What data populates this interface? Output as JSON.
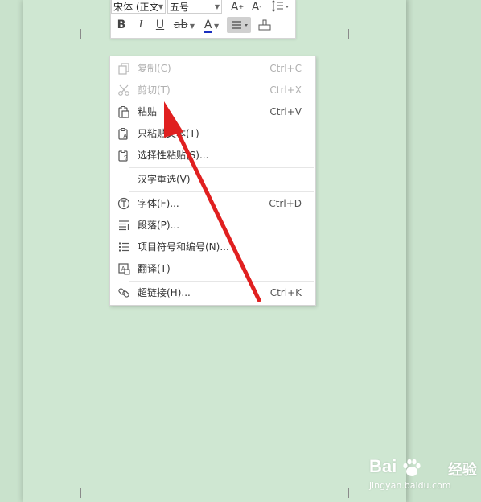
{
  "toolbar": {
    "font_name": "宋体 (正文",
    "font_size": "五号",
    "grow_font": "A",
    "shrink_font": "A",
    "bold": "B",
    "italic": "I",
    "underline": "U",
    "highlight": "ab",
    "font_color": "A"
  },
  "menu": {
    "items": [
      {
        "label": "复制(C)",
        "shortcut": "Ctrl+C",
        "icon": "copy-icon",
        "enabled": false
      },
      {
        "label": "剪切(T)",
        "shortcut": "Ctrl+X",
        "icon": "scissors-icon",
        "enabled": false
      },
      {
        "label": "粘贴",
        "shortcut": "Ctrl+V",
        "icon": "paste-icon",
        "enabled": true
      },
      {
        "label": "只粘贴文本(T)",
        "shortcut": "",
        "icon": "paste-text-icon",
        "enabled": true
      },
      {
        "label": "选择性粘贴(S)...",
        "shortcut": "",
        "icon": "paste-special-icon",
        "enabled": true
      },
      {
        "label": "汉字重选(V)",
        "shortcut": "",
        "icon": "",
        "enabled": true
      },
      {
        "label": "字体(F)...",
        "shortcut": "Ctrl+D",
        "icon": "font-icon",
        "enabled": true
      },
      {
        "label": "段落(P)...",
        "shortcut": "",
        "icon": "paragraph-icon",
        "enabled": true
      },
      {
        "label": "项目符号和编号(N)...",
        "shortcut": "",
        "icon": "bullet-list-icon",
        "enabled": true
      },
      {
        "label": "翻译(T)",
        "shortcut": "",
        "icon": "translate-icon",
        "enabled": true
      },
      {
        "label": "超链接(H)...",
        "shortcut": "Ctrl+K",
        "icon": "link-icon",
        "enabled": true
      }
    ]
  },
  "watermark": {
    "brand": "Bai",
    "brand_suffix": "经验",
    "url": "jingyan.baidu.com"
  },
  "colors": {
    "page_bg": "#cfe7d2",
    "arrow": "#e02020",
    "font_color_bar": "#1a2fbf"
  }
}
